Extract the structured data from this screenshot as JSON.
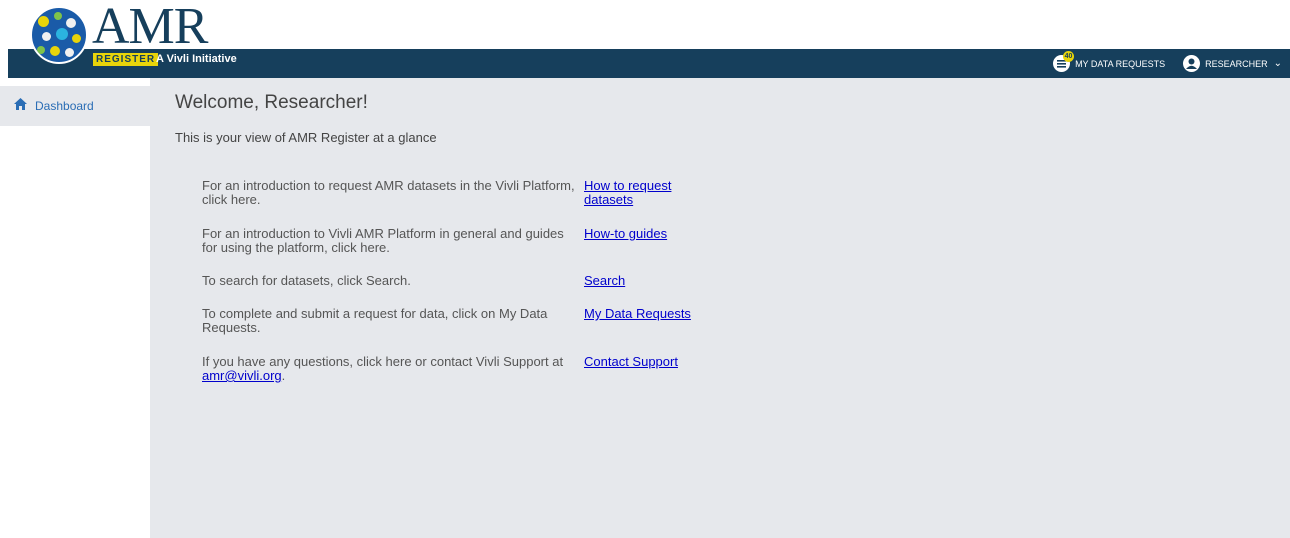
{
  "header": {
    "logo_text": "AMR",
    "register_badge": "REGISTER",
    "initiative": "A Vivli Initiative",
    "data_requests_label": "MY DATA REQUESTS",
    "data_requests_count": "40",
    "user_label": "RESEARCHER",
    "bar_color": "#163f5c",
    "badge_color": "#e8d40a"
  },
  "sidebar": {
    "items": [
      {
        "label": "Dashboard",
        "icon": "home-icon"
      }
    ]
  },
  "main": {
    "title": "Welcome, Researcher!",
    "subtitle": "This is your view of AMR Register at a glance",
    "rows": [
      {
        "text": "For an introduction to request AMR datasets in the Vivli Platform, click here.",
        "link": "How to request datasets"
      },
      {
        "text": "For an introduction to Vivli AMR Platform in general and guides for using the platform, click here.",
        "link": "How-to guides"
      },
      {
        "text": "To search for datasets, click Search.",
        "link": "Search"
      },
      {
        "text": "To complete and submit a request for data, click on My Data Requests.",
        "link": "My Data Requests"
      },
      {
        "text_before_email": "If you have any questions, click here or contact Vivli Support at ",
        "email": "amr@vivli.org",
        "text_after_email": ".",
        "link": "Contact Support"
      }
    ]
  }
}
